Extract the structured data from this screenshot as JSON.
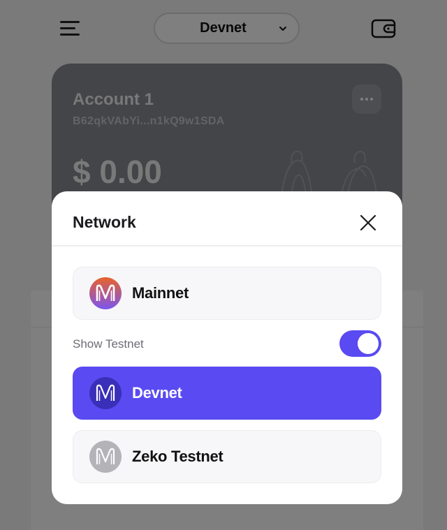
{
  "header": {
    "network_label": "Devnet",
    "menu_icon": "hamburger-menu-icon",
    "wallet_icon": "wallet-icon",
    "chevron_icon": "chevron-down-icon"
  },
  "account": {
    "name": "Account 1",
    "address": "B62qkVAbYi...n1kQ9w1SDA",
    "balance": "$ 0.00",
    "more_icon": "more-dots-icon"
  },
  "modal": {
    "title": "Network",
    "close_icon": "close-icon",
    "networks": [
      {
        "label": "Mainnet",
        "icon": "mina-mainnet-logo-icon"
      },
      {
        "label": "Devnet",
        "icon": "mina-devnet-logo-icon",
        "selected": true
      },
      {
        "label": "Zeko Testnet",
        "icon": "mina-zeko-logo-icon"
      }
    ],
    "show_testnet": {
      "label": "Show Testnet",
      "enabled": true
    }
  },
  "colors": {
    "accent": "#594af1",
    "card": "#898a91",
    "overlay": "rgba(0,0,0,0.5)"
  }
}
